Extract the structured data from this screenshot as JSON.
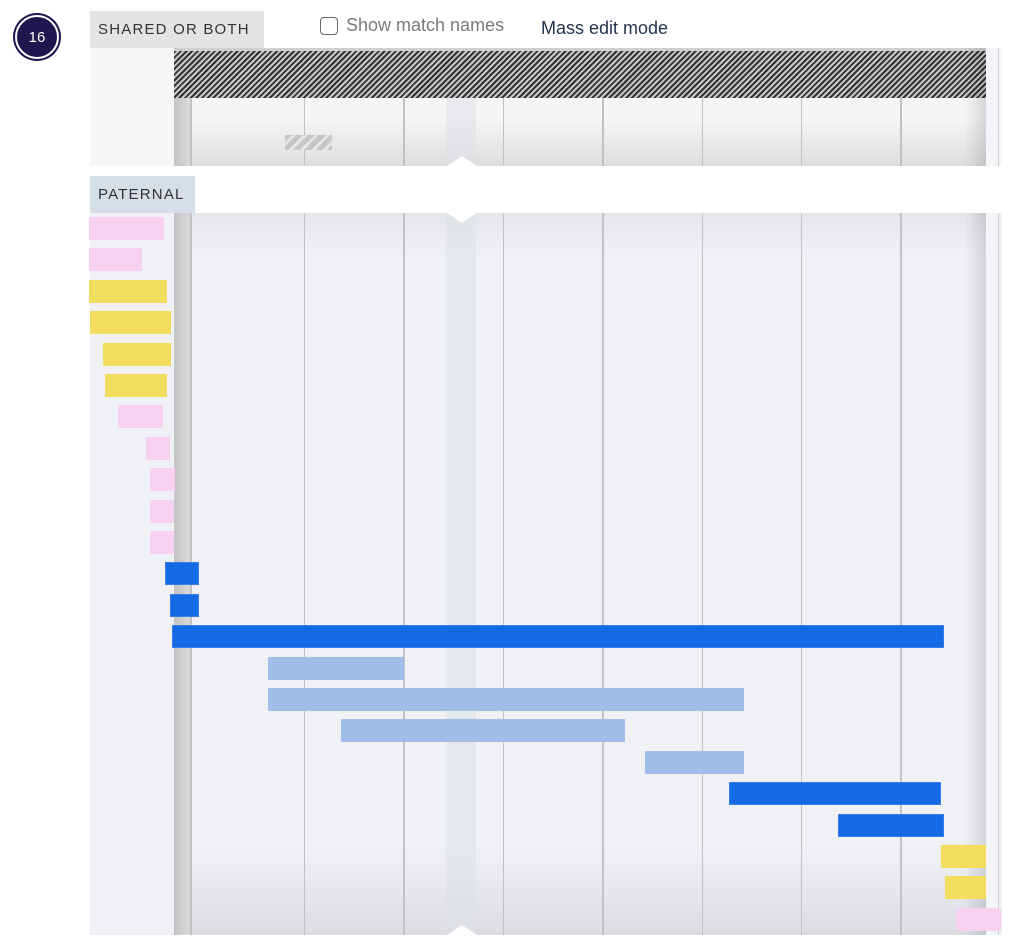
{
  "chromosome_badge": "16",
  "sections": {
    "shared_label": "SHARED OR BOTH",
    "paternal_label": "PATERNAL"
  },
  "controls": {
    "show_match_names_label": "Show match names",
    "show_match_names_checked": false,
    "mass_edit_label": "Mass edit mode"
  },
  "colors": {
    "badge": "#1f1650",
    "strong_blue": "#1469e4",
    "light_blue": "#a3bde9",
    "yellow": "#f2dd5e",
    "pink": "#f7d2f0"
  },
  "track": {
    "gridline_fractions": [
      0.0,
      0.143,
      0.268,
      0.393,
      0.518,
      0.643,
      0.767,
      0.892
    ],
    "center_band": {
      "start": 0.335,
      "end": 0.372
    }
  },
  "shared_segments": [
    {
      "kind": "hatched-full",
      "start": 0.0,
      "end": 1.0
    },
    {
      "kind": "hatched-partial",
      "start": 0.137,
      "end": 0.194
    }
  ],
  "paternal_segments": [
    {
      "row": 0,
      "color": "pink",
      "start": -0.105,
      "end": -0.012
    },
    {
      "row": 1,
      "color": "pink",
      "start": -0.105,
      "end": -0.039
    },
    {
      "row": 2,
      "color": "yellow",
      "start": -0.105,
      "end": -0.009
    },
    {
      "row": 3,
      "color": "yellow",
      "start": -0.103,
      "end": -0.004
    },
    {
      "row": 4,
      "color": "yellow",
      "start": -0.087,
      "end": -0.004
    },
    {
      "row": 5,
      "color": "yellow",
      "start": -0.085,
      "end": -0.009
    },
    {
      "row": 6,
      "color": "pink",
      "start": -0.069,
      "end": -0.013
    },
    {
      "row": 7,
      "color": "pink",
      "start": -0.035,
      "end": -0.005
    },
    {
      "row": 8,
      "color": "pink",
      "start": -0.03,
      "end": 0.001
    },
    {
      "row": 9,
      "color": "pink",
      "start": -0.03,
      "end": 0.0
    },
    {
      "row": 10,
      "color": "pink",
      "start": -0.03,
      "end": 0.0
    },
    {
      "row": 11,
      "color": "strong_blue",
      "start": -0.011,
      "end": 0.031
    },
    {
      "row": 12,
      "color": "strong_blue",
      "start": -0.005,
      "end": 0.031
    },
    {
      "row": 13,
      "color": "strong_blue",
      "start": -0.003,
      "end": 0.948
    },
    {
      "row": 14,
      "color": "light_blue",
      "start": 0.116,
      "end": 0.283
    },
    {
      "row": 15,
      "color": "light_blue",
      "start": 0.116,
      "end": 0.702
    },
    {
      "row": 16,
      "color": "light_blue",
      "start": 0.206,
      "end": 0.556
    },
    {
      "row": 17,
      "color": "light_blue",
      "start": 0.58,
      "end": 0.702
    },
    {
      "row": 18,
      "color": "strong_blue",
      "start": 0.683,
      "end": 0.944
    },
    {
      "row": 19,
      "color": "strong_blue",
      "start": 0.818,
      "end": 0.948
    },
    {
      "row": 20,
      "color": "yellow",
      "start": 0.945,
      "end": 1.0
    },
    {
      "row": 21,
      "color": "yellow",
      "start": 0.949,
      "end": 1.0
    },
    {
      "row": 22,
      "color": "pink",
      "start": 0.963,
      "end": 1.018
    }
  ]
}
